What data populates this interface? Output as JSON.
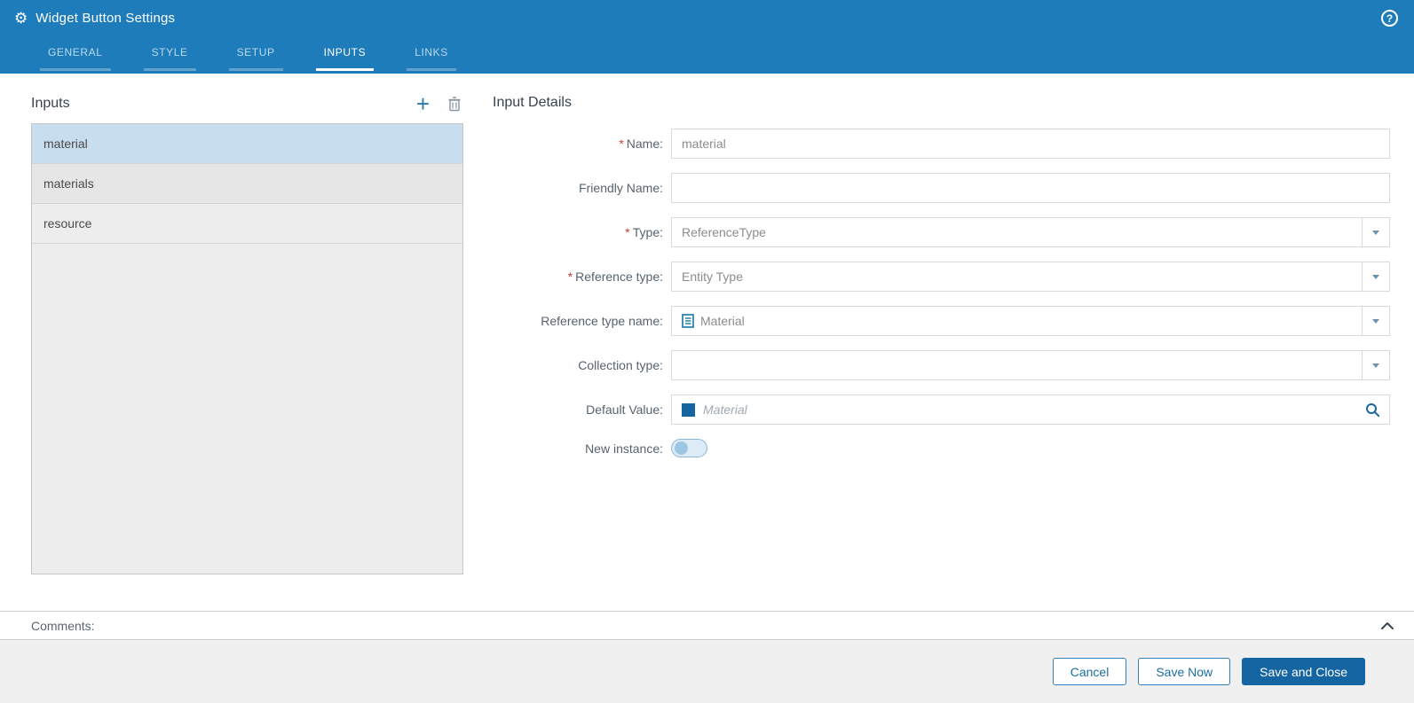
{
  "ui": {
    "required_marker": "*"
  },
  "titlebar": {
    "gear_icon": "⚙",
    "title": "Widget Button Settings",
    "help_icon": "?"
  },
  "tabs": {
    "general": "GENERAL",
    "style": "STYLE",
    "setup": "SETUP",
    "inputs": "INPUTS",
    "links": "LINKS",
    "active_tab": "INPUTS"
  },
  "inputs_panel": {
    "title": "Inputs",
    "add_icon": "+",
    "trash_icon": "trash",
    "items": [
      {
        "label": "material",
        "selected": true
      },
      {
        "label": "materials",
        "selected": false
      },
      {
        "label": "resource",
        "selected": false
      }
    ]
  },
  "details": {
    "title": "Input Details",
    "name": {
      "label": "Name:",
      "required": true,
      "value": "material"
    },
    "friendly_name": {
      "label": "Friendly Name:",
      "required": false,
      "value": ""
    },
    "type": {
      "label": "Type:",
      "required": true,
      "value": "ReferenceType"
    },
    "reference_type": {
      "label": "Reference type:",
      "required": true,
      "value": "Entity Type"
    },
    "reference_type_name": {
      "label": "Reference type name:",
      "required": false,
      "value": "Material"
    },
    "collection_type": {
      "label": "Collection type:",
      "required": false,
      "value": ""
    },
    "default_value": {
      "label": "Default Value:",
      "required": false,
      "placeholder": "Material"
    },
    "new_instance": {
      "label": "New instance:",
      "state": "off"
    }
  },
  "comments": {
    "label": "Comments:"
  },
  "footer": {
    "cancel_label": "Cancel",
    "save_now_label": "Save Now",
    "save_close_label": "Save and Close"
  },
  "colors": {
    "header_blue": "#1e7cba",
    "primary_button_blue": "#1565a3",
    "accent_blue": "#1a6ea0",
    "selected_row_blue": "#c8ddee",
    "required_red": "#ca3b38",
    "swatch_blue": "#1464a0"
  }
}
